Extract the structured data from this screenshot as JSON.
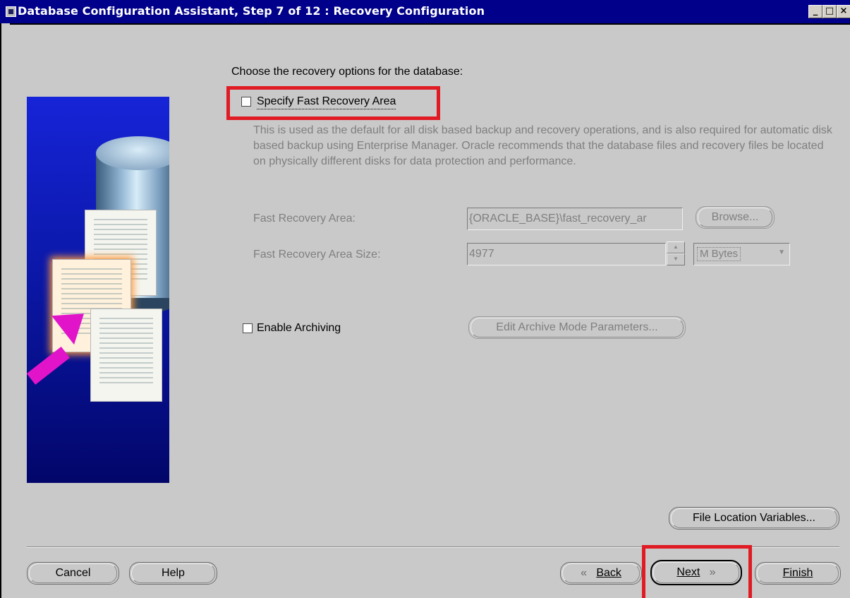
{
  "window": {
    "title": "Database Configuration Assistant, Step 7 of 12 : Recovery Configuration",
    "controls": {
      "minimize": "_",
      "maximize": "□",
      "close": "×"
    }
  },
  "main": {
    "heading": "Choose the recovery options for the database:",
    "fast_recovery": {
      "checkbox_label": "Specify Fast Recovery Area",
      "checked": false,
      "description": "This is used as the default for all disk based backup and recovery operations, and is also required for automatic disk based backup using Enterprise Manager. Oracle recommends that the database files and recovery files be located on physically different disks for data protection and performance.",
      "area_label": "Fast Recovery Area:",
      "area_value": "{ORACLE_BASE}\\fast_recovery_ar",
      "browse_label": "Browse...",
      "size_label": "Fast Recovery Area Size:",
      "size_value": "4977",
      "unit_value": "M Bytes"
    },
    "archiving": {
      "checkbox_label": "Enable Archiving",
      "checked": false,
      "edit_params_label": "Edit Archive Mode Parameters..."
    },
    "file_location_label": "File Location Variables..."
  },
  "footer": {
    "cancel_label": "Cancel",
    "help_label": "Help",
    "back_label": "Back",
    "next_label": "Next",
    "finish_label": "Finish"
  },
  "colors": {
    "titlebar": "#00008a",
    "dialog_bg": "#c9c9c9",
    "highlight_red": "#e01b24",
    "disabled_text": "#7f7f7f"
  }
}
